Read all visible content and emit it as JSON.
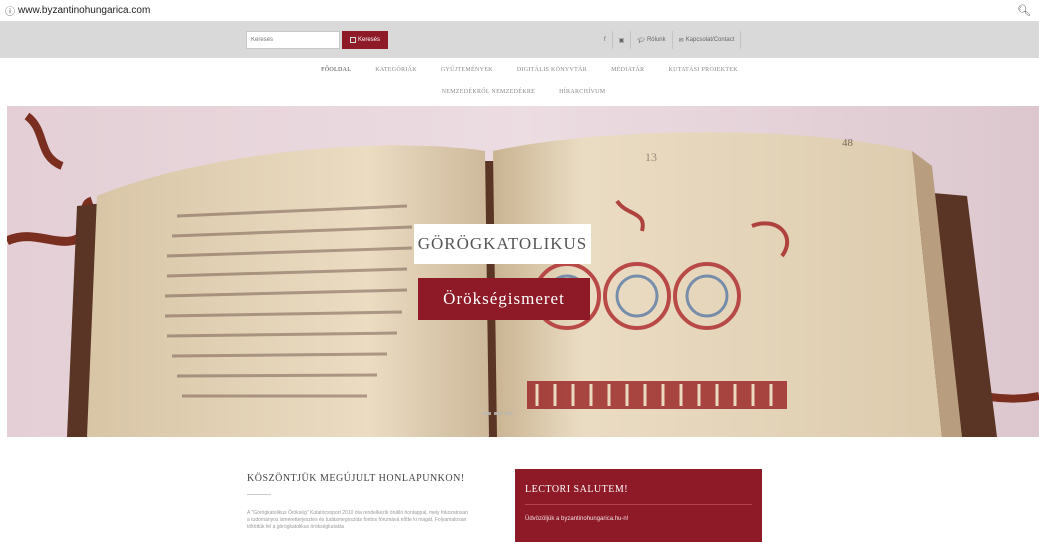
{
  "browser": {
    "info_icon": "info-circle-icon",
    "url": "www.byzantinohungarica.com",
    "zoom_icon": "magnifier-icon"
  },
  "topbar": {
    "search_placeholder": "Keresés",
    "search_button_label": "Keresés",
    "links": [
      {
        "icon": "facebook-icon",
        "label": "f"
      },
      {
        "icon": "youtube-icon",
        "label": "▣"
      },
      {
        "icon": "graduation-cap-icon",
        "label": "Rólunk"
      },
      {
        "icon": "envelope-icon",
        "label": "Kapcsolat/Contact"
      }
    ]
  },
  "nav": {
    "row1": [
      "Főoldal",
      "Kategóriák",
      "Gyűjtemények",
      "Digitális könyvtár",
      "Médiatár",
      "Kutatási projektek"
    ],
    "row2": [
      "Nemzedékről nemzedékre",
      "Hírarchívum"
    ]
  },
  "hero": {
    "title": "Görögkatolikus",
    "subtitle": "Örökségismeret",
    "slides": 3,
    "colors": {
      "accent": "#8e1a28",
      "background": "#e8d6dc"
    }
  },
  "welcome": {
    "title": "Köszöntjük megújult honlapunkon!",
    "text": "A \"Görögkatolikus Örökség\" Kutatócsoport 2010 óta rendelkezik önálló honlappal, mely fokozatosan a tudományos ismeretterjesztés és tudásmegosztás fontos fórumává nőtte ki magát. Folyamatosan töltöttük fel a görögkatolikus örökségkutatás"
  },
  "lectori": {
    "title": "Lectori salutem!",
    "text": "Üdvözöljük a byzantinohungarica.hu-n!"
  }
}
